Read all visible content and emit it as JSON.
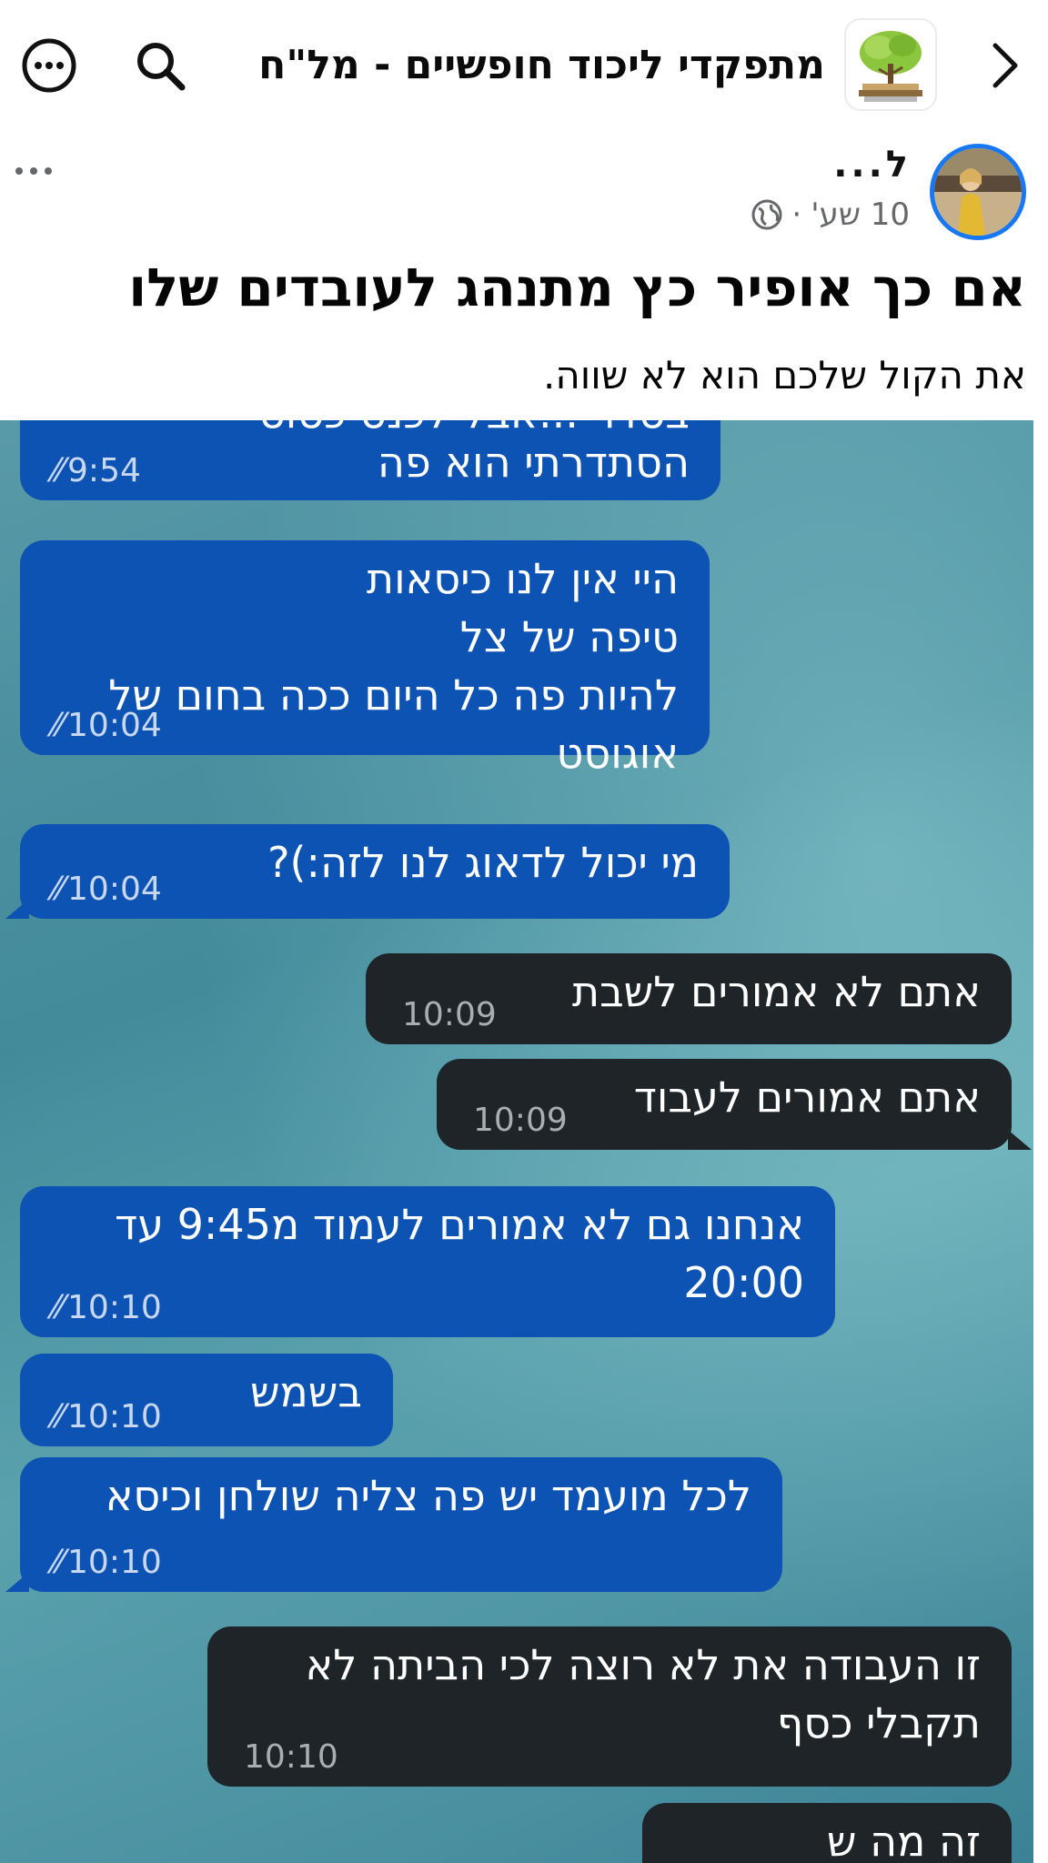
{
  "header": {
    "group_name": "מתפקדי ליכוד חופשיים - מל\"ח",
    "back_icon": "chevron-right-icon",
    "search_icon": "search-icon",
    "more_icon": "more-circle-icon",
    "group_image": "tree-on-books-image"
  },
  "post": {
    "author_name": "ל...",
    "time": "10 שע'",
    "separator": "·",
    "privacy_icon": "globe-icon",
    "title": "אם כך אופיר כץ מתנהג לעובדים שלו",
    "subtitle": "את הקול שלכם הוא לא שווה.",
    "menu_icon": "ellipsis-icon"
  },
  "chat": {
    "messages": [
      {
        "dir": "in",
        "text": "הסתדרתי הוא פה",
        "time": "9:54",
        "top_cut": "בסדר ...אבל לכנס כסוס"
      },
      {
        "dir": "in",
        "text": "היי אין לנו כיסאות\nטיפה של צל\nלהיות פה כל היום ככה בחום של\nאוגוסט",
        "time": "10:04"
      },
      {
        "dir": "in",
        "text": "מי יכול לדאוג לנו לזה:)?",
        "time": "10:04"
      },
      {
        "dir": "out",
        "text": "אתם לא אמורים לשבת",
        "time": "10:09"
      },
      {
        "dir": "out",
        "text": "אתם אמורים לעבוד",
        "time": "10:09"
      },
      {
        "dir": "in",
        "text": "אנחנו גם לא אמורים לעמוד מ9:45 עד\n20:00",
        "time": "10:10"
      },
      {
        "dir": "in",
        "text": "בשמש",
        "time": "10:10"
      },
      {
        "dir": "in",
        "text": "לכל מועמד יש פה צליה שולחן וכיסא",
        "time": "10:10"
      },
      {
        "dir": "out",
        "text": "זו העבודה את לא רוצה לכי הביתה לא\nתקבלי כסף",
        "time": "10:10"
      },
      {
        "dir": "out",
        "text": "זה מה ש",
        "time": ""
      }
    ]
  },
  "colors": {
    "incoming_bubble": "#0d53b4",
    "outgoing_bubble": "#1e2428",
    "avatar_ring": "#1877f2"
  }
}
